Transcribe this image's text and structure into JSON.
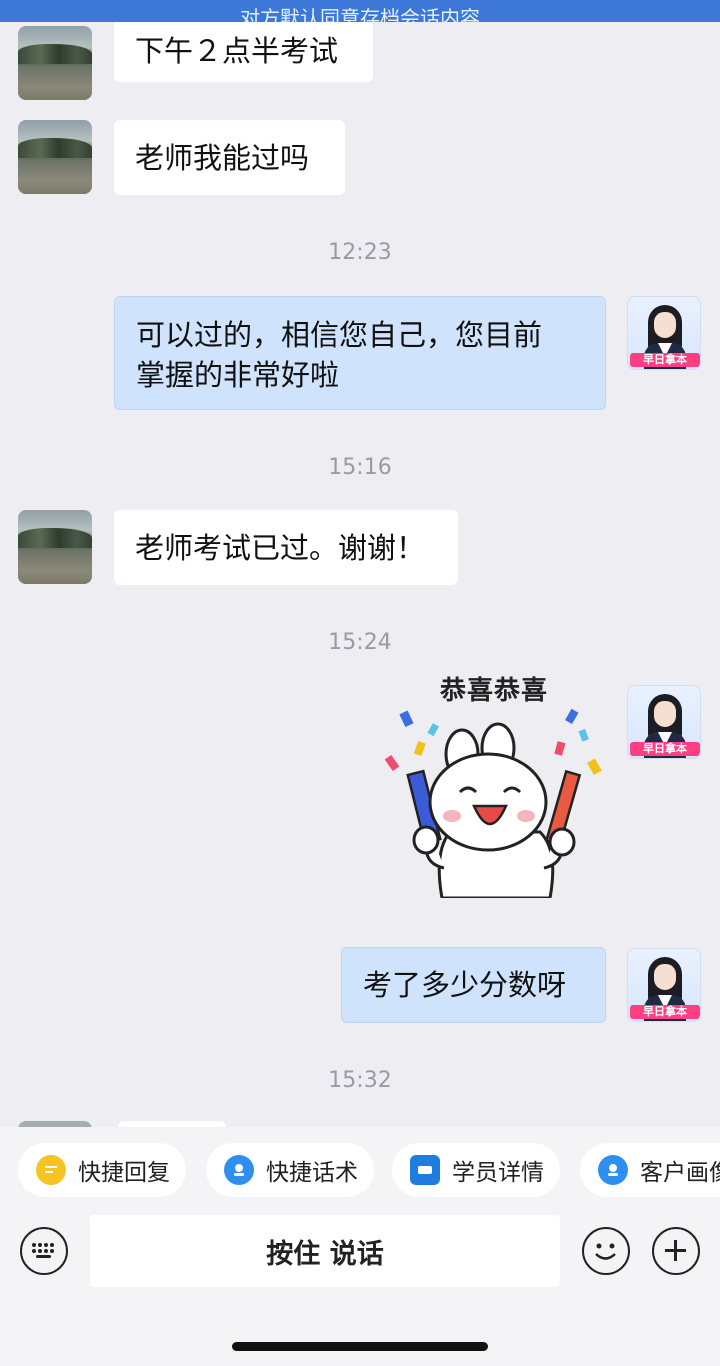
{
  "banner": {
    "text": "对方默认同意存档会话内容"
  },
  "messages": [
    {
      "side": "left",
      "text": "下午２点半考试"
    },
    {
      "side": "left",
      "text": "老师我能过吗"
    },
    {
      "type": "time",
      "text": "12:23"
    },
    {
      "side": "right",
      "line1": "可以过的，相信您自己，您目前",
      "line2": "掌握的非常好啦"
    },
    {
      "type": "time",
      "text": "15:16"
    },
    {
      "side": "left",
      "text": "老师考试已过。谢谢！"
    },
    {
      "type": "time",
      "text": "15:24"
    },
    {
      "side": "right",
      "sticker_caption": "恭喜恭喜"
    },
    {
      "side": "right",
      "text": "考了多少分数呀"
    },
    {
      "type": "time",
      "text": "15:32"
    }
  ],
  "avatar_tag": "早日拿本",
  "toolbar": {
    "chips": [
      {
        "label": "快捷回复",
        "icon": "quick-reply-icon"
      },
      {
        "label": "快捷话术",
        "icon": "script-icon"
      },
      {
        "label": "学员详情",
        "icon": "student-detail-icon"
      },
      {
        "label": "客户画像",
        "icon": "customer-profile-icon"
      }
    ],
    "talk_label": "按住 说话"
  },
  "colors": {
    "banner": "#3d78d8",
    "bubble_right": "#cfe4fc",
    "bubble_left": "#ffffff",
    "background": "#ededf2",
    "avatar_tag": "#ff3f82"
  }
}
